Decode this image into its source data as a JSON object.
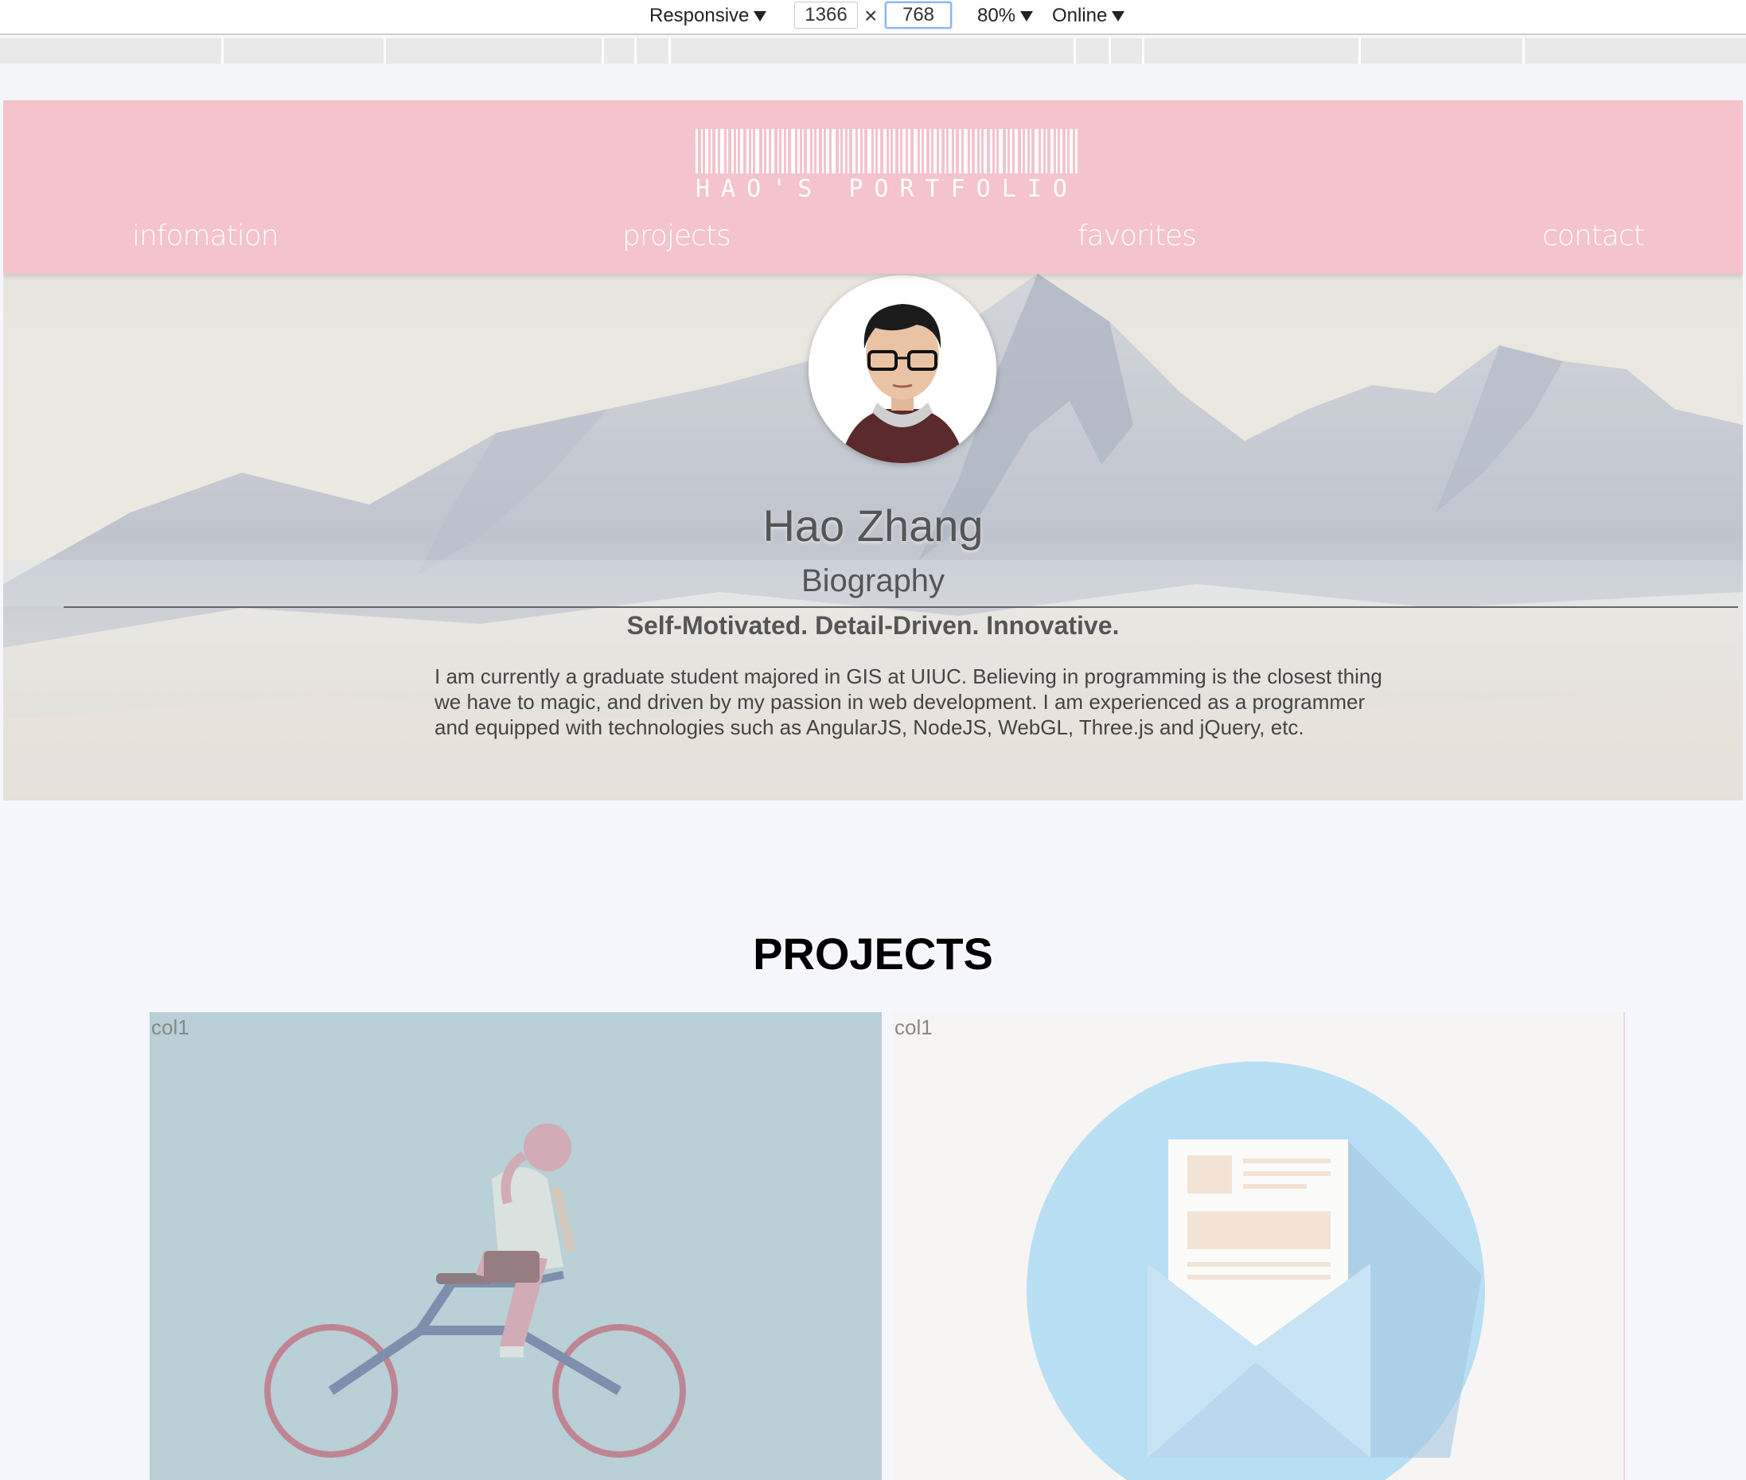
{
  "devtools": {
    "device_mode": "Responsive",
    "width": "1366",
    "times": "×",
    "height": "768",
    "zoom": "80%",
    "network": "Online"
  },
  "header": {
    "logo_text": "HAO'S PORTFOLIO",
    "nav": [
      "infomation",
      "projects",
      "favorites",
      "contact"
    ]
  },
  "hero": {
    "name": "Hao Zhang",
    "section_title": "Biography",
    "tagline": "Self-Motivated. Detail-Driven. Innovative.",
    "bio": "I am currently a graduate student majored in GIS at UIUC. Believing in programming is the closest thing we have to magic, and driven by my passion in web development. I am experienced as a programmer and equipped with technologies such as AngularJS, NodeJS, WebGL, Three.js and jQuery, etc."
  },
  "projects": {
    "title": "PROJECTS",
    "cards": [
      {
        "label": "col1"
      },
      {
        "label": "col1"
      }
    ]
  },
  "colors": {
    "header_bg": "#f4c3cc",
    "page_bg": "#f6f7fd",
    "card_left_bg": "#b8d0d6",
    "card_right_bg": "#f7f5f3"
  }
}
